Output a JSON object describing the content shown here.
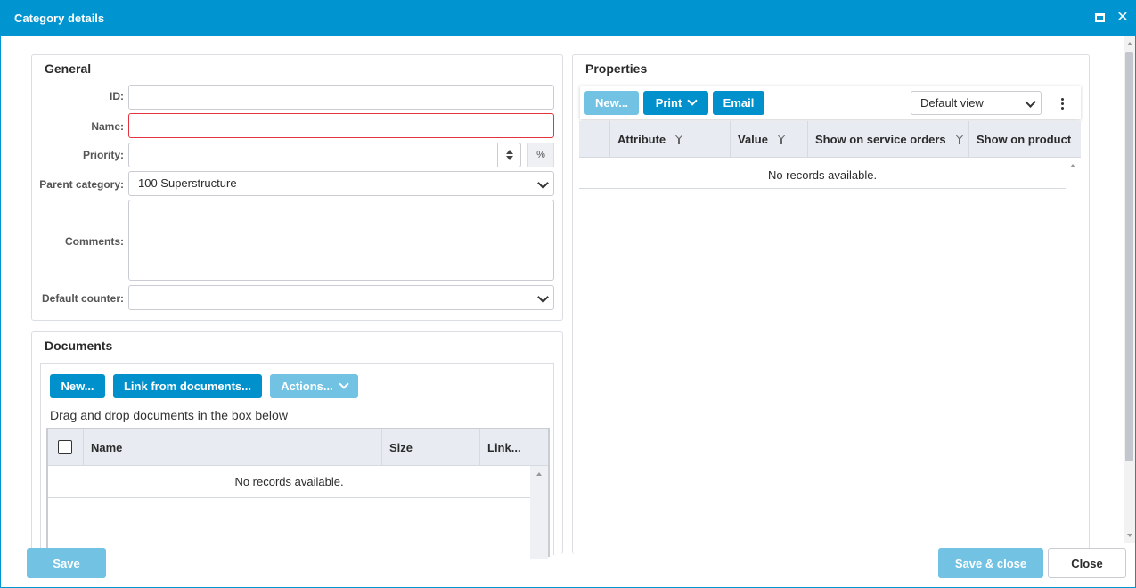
{
  "window": {
    "title": "Category details"
  },
  "general": {
    "title": "General",
    "fields": {
      "id": {
        "label": "ID:",
        "value": ""
      },
      "name": {
        "label": "Name:",
        "value": ""
      },
      "priority": {
        "label": "Priority:",
        "value": "",
        "addon": "%"
      },
      "parent_category": {
        "label": "Parent category:",
        "value": "100 Superstructure"
      },
      "comments": {
        "label": "Comments:",
        "value": ""
      },
      "default_counter": {
        "label": "Default counter:",
        "value": ""
      }
    }
  },
  "documents": {
    "title": "Documents",
    "new_label": "New...",
    "link_label": "Link from documents...",
    "actions_label": "Actions...",
    "hint": "Drag and drop documents in the box below",
    "columns": [
      "Name",
      "Size",
      "Link..."
    ],
    "empty": "No records available."
  },
  "properties": {
    "title": "Properties",
    "new_label": "New...",
    "print_label": "Print",
    "email_label": "Email",
    "view_value": "Default view",
    "columns": [
      "Attribute",
      "Value",
      "Show on service orders",
      "Show on product"
    ],
    "empty": "No records available."
  },
  "footer": {
    "save_label": "Save",
    "save_close_label": "Save & close",
    "close_label": "Close"
  },
  "colors": {
    "accent": "#0095d0",
    "button": "#0090cc",
    "button_disabled": "#72c2e4",
    "required_border": "#e2333f"
  }
}
